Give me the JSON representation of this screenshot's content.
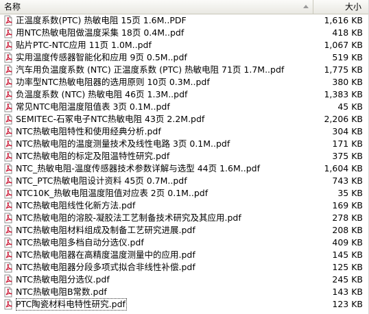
{
  "columns": {
    "name": "名称",
    "size": "大小"
  },
  "files": [
    {
      "name": "正温度系数(PTC) 热敏电阻 15页 1.6M..PDF",
      "size": "1,616 KB"
    },
    {
      "name": "用NTC热敏电阻做温度采集 18页 0.4M..pdf",
      "size": "418 KB"
    },
    {
      "name": "贴片PTC-NTC应用 11页 1.0M..pdf",
      "size": "1,067 KB"
    },
    {
      "name": "实用温度传感器智能化和应用 9页 0.5M..pdf",
      "size": "519 KB"
    },
    {
      "name": "汽车用负温度系数 (NTC) 正温度系数 (PTC) 热敏电阻 71页 1.7M..pdf",
      "size": "1,775 KB"
    },
    {
      "name": "功率型NTC热敏电阻器的选用原则 10页 0.3M..pdf",
      "size": "380 KB"
    },
    {
      "name": "负温度系数 (NTC) 热敏电阻 46页 1.3M..pdf",
      "size": "1,383 KB"
    },
    {
      "name": "常见NTC电阻温度阻值表 3页 0.1M..pdf",
      "size": "45 KB"
    },
    {
      "name": "SEMITEC-石冢电子NTC热敏电阻 43页 2.2M.pdf",
      "size": "2,206 KB"
    },
    {
      "name": "NTC热敏电阻特性和使用经典分析.pdf",
      "size": "304 KB"
    },
    {
      "name": "NTC热敏电阻的温度测量技术及线性电路 3页 0.1M..pdf",
      "size": "171 KB"
    },
    {
      "name": "NTC热敏电阻的标定及阻温特性研究.pdf",
      "size": "375 KB"
    },
    {
      "name": "NTC_热敏电阻-温度传感器技术参数详解与选型 44页 1.6M..pdf",
      "size": "1,604 KB"
    },
    {
      "name": "NTC_PTC热敏电阻设计资料 45页 0.7M..pdf",
      "size": "743 KB"
    },
    {
      "name": "NTC10K_热敏电阻温度阻值对应表 2页 0.1M..pdf",
      "size": "35 KB"
    },
    {
      "name": "NTC热敏电阻线性化新方法.pdf",
      "size": "169 KB"
    },
    {
      "name": "NTC热敏电阻的溶胶-凝胶法工艺制备技术研究及其应用.pdf",
      "size": "278 KB"
    },
    {
      "name": "NTC热敏电阻材料组成及制备工艺研究进展.pdf",
      "size": "208 KB"
    },
    {
      "name": "NTC热敏电阻多档自动分选仪.pdf",
      "size": "409 KB"
    },
    {
      "name": "NTC热敏电阻器在高精度温度测量中的应用.pdf",
      "size": "145 KB"
    },
    {
      "name": "NTC热敏电阻器分段多项式拟合非线性补偿.pdf",
      "size": "125 KB"
    },
    {
      "name": "NTC热敏电阻分选仪.pdf",
      "size": "245 KB"
    },
    {
      "name": "NTC热敏电阻B常数.pdf",
      "size": "143 KB"
    },
    {
      "name": "PTC陶瓷材料电特性研究.pdf",
      "size": "123 KB"
    }
  ]
}
